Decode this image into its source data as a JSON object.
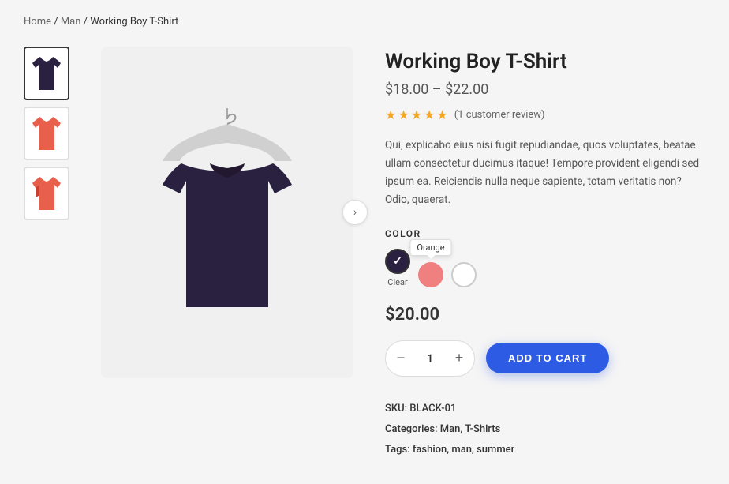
{
  "breadcrumb": {
    "items": [
      "Home",
      "Man",
      "Working Boy T-Shirt"
    ],
    "separator": "/"
  },
  "thumbnails": [
    {
      "id": "thumb-black",
      "color": "#2a2040",
      "active": true
    },
    {
      "id": "thumb-orange",
      "color": "#e8604c",
      "active": false
    },
    {
      "id": "thumb-orange2",
      "color": "#e8604c",
      "active": false
    }
  ],
  "product": {
    "title": "Working Boy T-Shirt",
    "price_range": "$18.00 – $22.00",
    "rating": 5,
    "review_count": "(1 customer review)",
    "description": "Qui, explicabo eius nisi fugit repudiandae, quos voluptates, beatae ullam consectetur ducimus itaque! Tempore provident eligendi sed ipsum ea. Reiciendis nulla neque sapiente, totam veritatis non? Odio, quaerat.",
    "color_label": "COLOR",
    "colors": [
      {
        "name": "black",
        "hex": "#2a2040",
        "active": true,
        "label": "Clear"
      },
      {
        "name": "orange",
        "hex": "#f08080",
        "active": false,
        "label": "Orange",
        "tooltip": "Orange"
      },
      {
        "name": "white",
        "hex": "#ffffff",
        "active": false,
        "label": ""
      }
    ],
    "current_price": "$20.00",
    "quantity": 1,
    "add_to_cart_label": "ADD TO CART",
    "sku": "BLACK-01",
    "categories": "Man, T-Shirts",
    "tags": "fashion, man, summer"
  },
  "labels": {
    "sku": "SKU:",
    "categories": "Categories:",
    "tags": "Tags:",
    "qty_minus": "−",
    "qty_plus": "+"
  },
  "icons": {
    "arrow_right": "›",
    "check": "✓"
  }
}
